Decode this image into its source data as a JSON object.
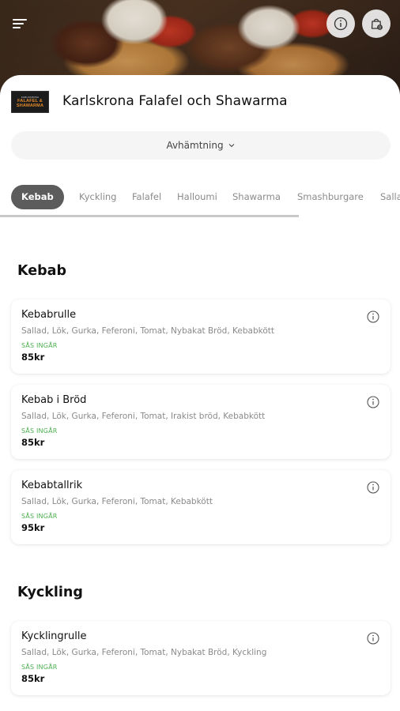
{
  "restaurant": {
    "name": "Karlskrona Falafel och Shawarma",
    "logo_top": "KARLSKRONA",
    "logo_line1": "FALAFEL &",
    "logo_line2": "SHAWARMA"
  },
  "header": {
    "menu_icon": "hamburger-menu-icon",
    "info_icon": "info-icon",
    "cart_icon": "shopping-bag-icon",
    "cart_count": "0"
  },
  "order_mode": {
    "label": "Avhämtning",
    "icon": "chevron-down-icon"
  },
  "tabs": [
    {
      "label": "Kebab",
      "active": true
    },
    {
      "label": "Kyckling",
      "active": false
    },
    {
      "label": "Falafel",
      "active": false
    },
    {
      "label": "Halloumi",
      "active": false
    },
    {
      "label": "Shawarma",
      "active": false
    },
    {
      "label": "Smashburgare",
      "active": false
    },
    {
      "label": "Sallad",
      "active": false
    }
  ],
  "sections": [
    {
      "title": "Kebab",
      "items": [
        {
          "name": "Kebabrulle",
          "description": "Sallad, Lök, Gurka, Feferoni, Tomat, Nybakat Bröd, Kebabkött",
          "note": "SÅS INGÅR",
          "price": "85kr"
        },
        {
          "name": "Kebab i Bröd",
          "description": "Sallad, Lök, Gurka, Feferoni, Tomat, Irakist bröd, Kebabkött",
          "note": "SÅS INGÅR",
          "price": "85kr"
        },
        {
          "name": "Kebabtallrik",
          "description": "Sallad, Lök, Gurka, Feferoni, Tomat, Kebabkött",
          "note": "SÅS INGÅR",
          "price": "95kr"
        }
      ]
    },
    {
      "title": "Kyckling",
      "items": [
        {
          "name": "Kycklingrulle",
          "description": "Sallad, Lök, Gurka, Feferoni, Tomat, Nybakat Bröd, Kyckling",
          "note": "SÅS INGÅR",
          "price": "85kr"
        }
      ]
    }
  ],
  "colors": {
    "active_tab": "#5c5c5c",
    "sauce_note": "#4caf50"
  }
}
